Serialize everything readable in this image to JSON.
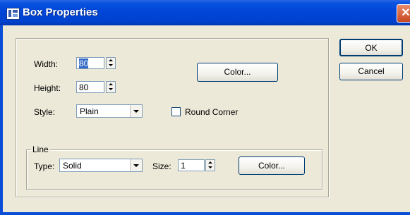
{
  "window": {
    "title": "Box Properties",
    "close_glyph": "✕",
    "icon": "box-properties-icon"
  },
  "size_group": {
    "width_label": "Width:",
    "width_value": "80",
    "height_label": "Height:",
    "height_value": "80",
    "color_button": "Color...",
    "style_label": "Style:",
    "style_value": "Plain",
    "round_corner_label": "Round Corner",
    "round_corner_checked": false
  },
  "line_group": {
    "title": "Line",
    "type_label": "Type:",
    "type_value": "Solid",
    "size_label": "Size:",
    "size_value": "1",
    "color_button": "Color..."
  },
  "buttons": {
    "ok": "OK",
    "cancel": "Cancel"
  },
  "colors": {
    "titlebar": "#0046d8",
    "dialog_bg": "#ece9d8",
    "selection": "#316ac5"
  }
}
